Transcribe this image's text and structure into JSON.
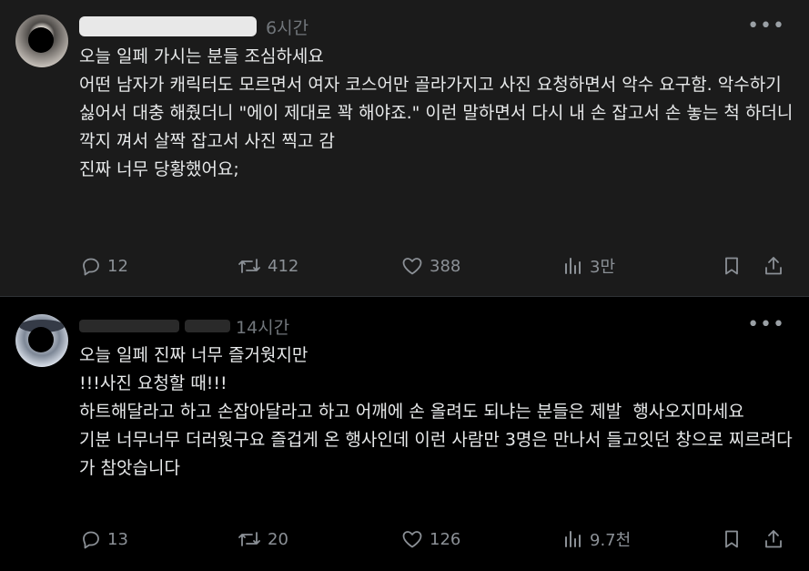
{
  "posts": [
    {
      "time": "6시간",
      "lines": [
        "오늘 일페 가시는 분들 조심하세요",
        "",
        "어떤 남자가 캐릭터도 모르면서 여자 코스어만 골라가지고 사진 요청하면서 악수 요구함. 악수하기 싫어서 대충 해줬더니 \"에이 제대로 꽉 해야죠.\" 이런 말하면서 다시 내 손 잡고서 손 놓는 척 하더니 깍지 껴서 살짝 잡고서 사진 찍고 감",
        "",
        "진짜 너무 당황했어요;"
      ],
      "replies": "12",
      "reposts": "412",
      "likes": "388",
      "views": "3만"
    },
    {
      "time": "14시간",
      "lines": [
        "오늘 일페 진짜 너무 즐거웟지만",
        "!!!사진 요청할 때!!!",
        "하트해달라고 하고 손잡아달라고 하고 어깨에 손 올려도 되냐는 분들은 제발  행사오지마세요",
        "기분 너무너무 더러웟구요 즐겁게 온 행사인데 이런 사람만 3명은 만나서 들고잇던 창으로 찌르려다가 참앗습니다"
      ],
      "replies": "13",
      "reposts": "20",
      "likes": "126",
      "views": "9.7천"
    }
  ],
  "icons": {
    "more": "more-dots-icon",
    "reply": "reply-bubble-icon",
    "repost": "repost-arrows-icon",
    "like": "heart-icon",
    "views": "views-bars-icon",
    "bookmark": "bookmark-icon",
    "share": "share-icon"
  },
  "colors": {
    "text": "#e7e9ea",
    "muted": "#71767b",
    "post1_bg": "#1b1b1b",
    "post2_bg": "#000000"
  }
}
